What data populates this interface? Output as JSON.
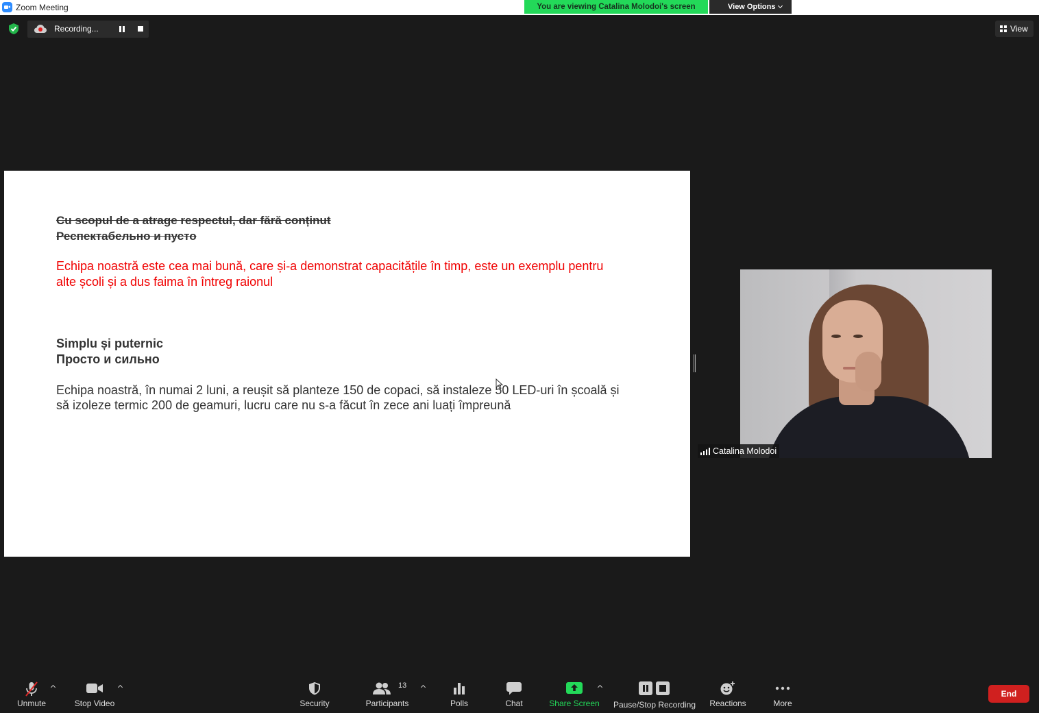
{
  "window": {
    "title": "Zoom Meeting"
  },
  "banner": {
    "viewing_text": "You are viewing Catalina Molodoi's screen",
    "view_options_label": "View Options"
  },
  "recording": {
    "status_text": "Recording..."
  },
  "view_button": {
    "label": "View"
  },
  "slide": {
    "strike_line_1": "Cu scopul de a atrage respectul, dar fără conținut",
    "strike_line_2": "Респектабельно и пусто",
    "red_line_1": "Echipa noastră este cea mai bună, care și-a demonstrat capacitățile în timp, este un exemplu pentru",
    "red_line_2": "alte școli și a dus faima în întreg raionul",
    "bold_line_1": "Simplu și puternic",
    "bold_line_2": "Просто и сильно",
    "body_line_1": "Echipa noastră, în numai 2 luni, a reușit să planteze 150 de copaci, să instaleze 50 LED-uri în școală și",
    "body_line_2": "să izoleze termic 200 de geamuri, lucru care nu s-a făcut în zece ani luați împreună"
  },
  "participant_video": {
    "name": "Catalina Molodoi"
  },
  "toolbar": {
    "unmute": "Unmute",
    "stop_video": "Stop Video",
    "security": "Security",
    "participants": "Participants",
    "participants_count": "13",
    "polls": "Polls",
    "chat": "Chat",
    "share_screen": "Share Screen",
    "pause_stop_recording": "Pause/Stop Recording",
    "reactions": "Reactions",
    "more": "More",
    "end": "End"
  },
  "colors": {
    "share_green": "#23d959",
    "end_red": "#d0201f",
    "slide_red": "#f00000"
  }
}
